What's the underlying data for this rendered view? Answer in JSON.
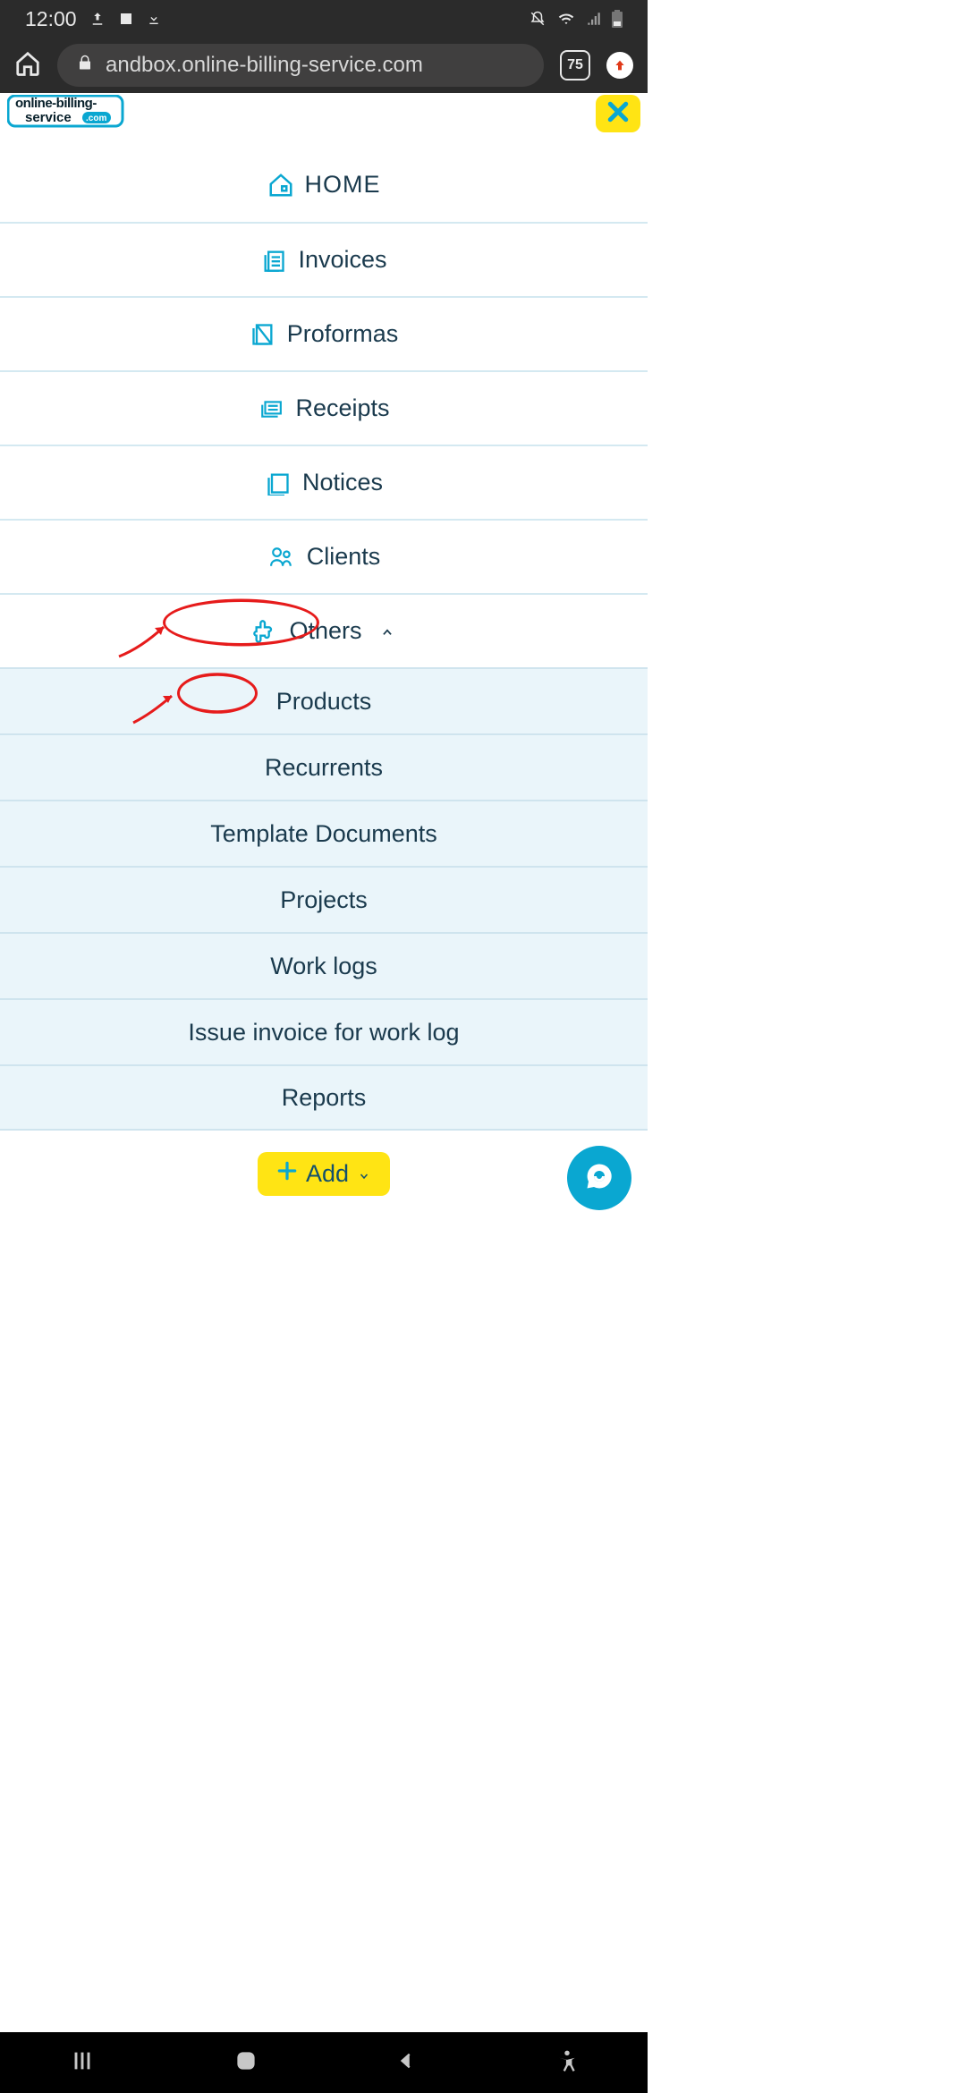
{
  "statusbar": {
    "time": "12:00"
  },
  "browser": {
    "url": "andbox.online-billing-service.com",
    "tab_count": "75"
  },
  "logo": {
    "line1": "online-billing-",
    "line2": "service",
    "badge": ".com"
  },
  "menu": {
    "home": "HOME",
    "invoices": "Invoices",
    "proformas": "Proformas",
    "receipts": "Receipts",
    "notices": "Notices",
    "clients": "Clients",
    "others": "Others"
  },
  "submenu": {
    "products": "Products",
    "recurrents": "Recurrents",
    "templates": "Template Documents",
    "projects": "Projects",
    "worklogs": "Work logs",
    "issue_worklog": "Issue invoice for work log",
    "reports": "Reports"
  },
  "add_button": "Add"
}
